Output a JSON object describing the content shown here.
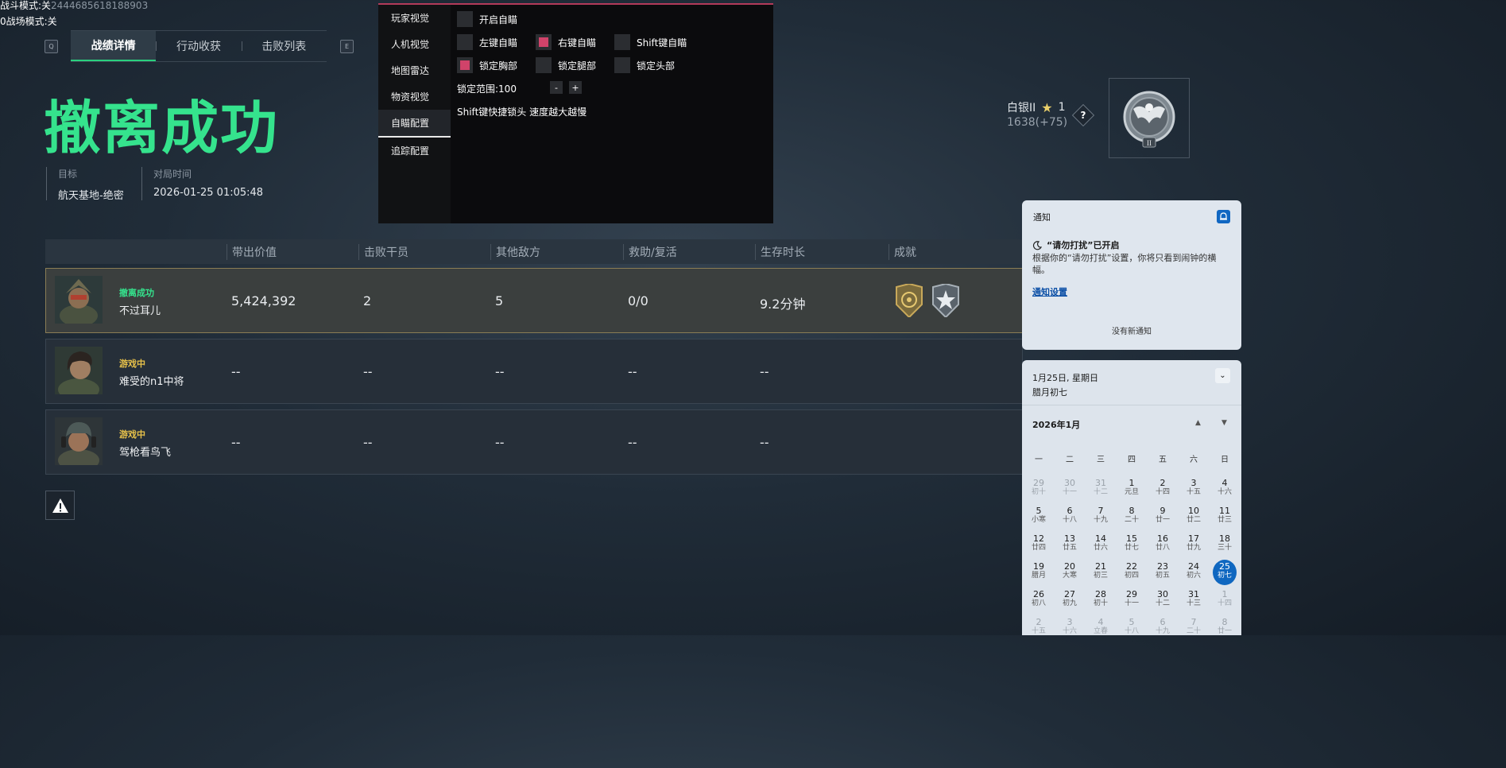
{
  "overlay": {
    "line1_label": "战斗模式:关",
    "line1_id": "2444685618188903",
    "line2_label": "0战场模式:关"
  },
  "tabs": {
    "key_left": "Q",
    "key_right": "E",
    "items": [
      "战绩详情",
      "行动收获",
      "击败列表"
    ]
  },
  "headline": "撤离成功",
  "meta": {
    "target_label": "目标",
    "target_value": "航天基地-绝密",
    "time_label": "对局时间",
    "time_value": "2026-01-25 01:05:48"
  },
  "cheat_menu": {
    "sidebar": [
      "玩家视觉",
      "人机视觉",
      "地图雷达",
      "物资视觉",
      "自瞄配置",
      "追踪配置"
    ],
    "enable": "开启自瞄",
    "left_aim": "左键自瞄",
    "right_aim": "右键自瞄",
    "shift_aim": "Shift键自瞄",
    "lock_chest": "锁定胸部",
    "lock_legs": "锁定腿部",
    "lock_head": "锁定头部",
    "range": "锁定范围:100",
    "minus": "-",
    "plus": "+",
    "hint": "Shift键快捷锁头 速度越大越慢"
  },
  "rank": {
    "name": "白银II",
    "stars": "1",
    "score": "1638(+75)",
    "help": "?",
    "badge_roman": "II"
  },
  "table": {
    "headers": [
      "带出价值",
      "击败干员",
      "其他敌方",
      "救助/复活",
      "生存时长",
      "成就"
    ],
    "rows": [
      {
        "status": "撤离成功",
        "name": "不过耳儿",
        "value": "5,424,392",
        "kills": "2",
        "others": "5",
        "rescue": "0/0",
        "time": "9.2分钟"
      },
      {
        "status": "游戏中",
        "name": "难受的n1中将",
        "value": "--",
        "kills": "--",
        "others": "--",
        "rescue": "--",
        "time": "--"
      },
      {
        "status": "游戏中",
        "name": "驾枪看鸟飞",
        "value": "--",
        "kills": "--",
        "others": "--",
        "rescue": "--",
        "time": "--"
      }
    ]
  },
  "notification": {
    "title": "通知",
    "dnd_title": "“请勿打扰”已开启",
    "dnd_body": "根据你的“请勿打扰”设置，你将只看到闹钟的横幅。",
    "settings_link": "通知设置",
    "empty": "没有新通知"
  },
  "calendar": {
    "date_line": "1月25日, 星期日",
    "lunar_line": "腊月初七",
    "month_label": "2026年1月",
    "weekdays": [
      "一",
      "二",
      "三",
      "四",
      "五",
      "六",
      "日"
    ],
    "days": [
      [
        "29",
        "初十",
        1
      ],
      [
        "30",
        "十一",
        1
      ],
      [
        "31",
        "十二",
        1
      ],
      [
        "1",
        "元旦",
        0
      ],
      [
        "2",
        "十四",
        0
      ],
      [
        "3",
        "十五",
        0
      ],
      [
        "4",
        "十六",
        0
      ],
      [
        "5",
        "小寒",
        0
      ],
      [
        "6",
        "十八",
        0
      ],
      [
        "7",
        "十九",
        0
      ],
      [
        "8",
        "二十",
        0
      ],
      [
        "9",
        "廿一",
        0
      ],
      [
        "10",
        "廿二",
        0
      ],
      [
        "11",
        "廿三",
        0
      ],
      [
        "12",
        "廿四",
        0
      ],
      [
        "13",
        "廿五",
        0
      ],
      [
        "14",
        "廿六",
        0
      ],
      [
        "15",
        "廿七",
        0
      ],
      [
        "16",
        "廿八",
        0
      ],
      [
        "17",
        "廿九",
        0
      ],
      [
        "18",
        "三十",
        0
      ],
      [
        "19",
        "腊月",
        0
      ],
      [
        "20",
        "大寒",
        0
      ],
      [
        "21",
        "初三",
        0
      ],
      [
        "22",
        "初四",
        0
      ],
      [
        "23",
        "初五",
        0
      ],
      [
        "24",
        "初六",
        0
      ],
      [
        "25",
        "初七",
        2
      ],
      [
        "26",
        "初八",
        0
      ],
      [
        "27",
        "初九",
        0
      ],
      [
        "28",
        "初十",
        0
      ],
      [
        "29",
        "十一",
        0
      ],
      [
        "30",
        "十二",
        0
      ],
      [
        "31",
        "十三",
        0
      ],
      [
        "1",
        "十四",
        1
      ],
      [
        "2",
        "十五",
        1
      ],
      [
        "3",
        "十六",
        1
      ],
      [
        "4",
        "立春",
        1
      ],
      [
        "5",
        "十八",
        1
      ],
      [
        "6",
        "十九",
        1
      ],
      [
        "7",
        "二十",
        1
      ],
      [
        "8",
        "廿一",
        1
      ]
    ]
  },
  "colors": {
    "accent_green": "#35e38d",
    "status_ingame": "#e8c24a",
    "checkbox_on": "#d0436a",
    "today": "#0f67c0"
  }
}
